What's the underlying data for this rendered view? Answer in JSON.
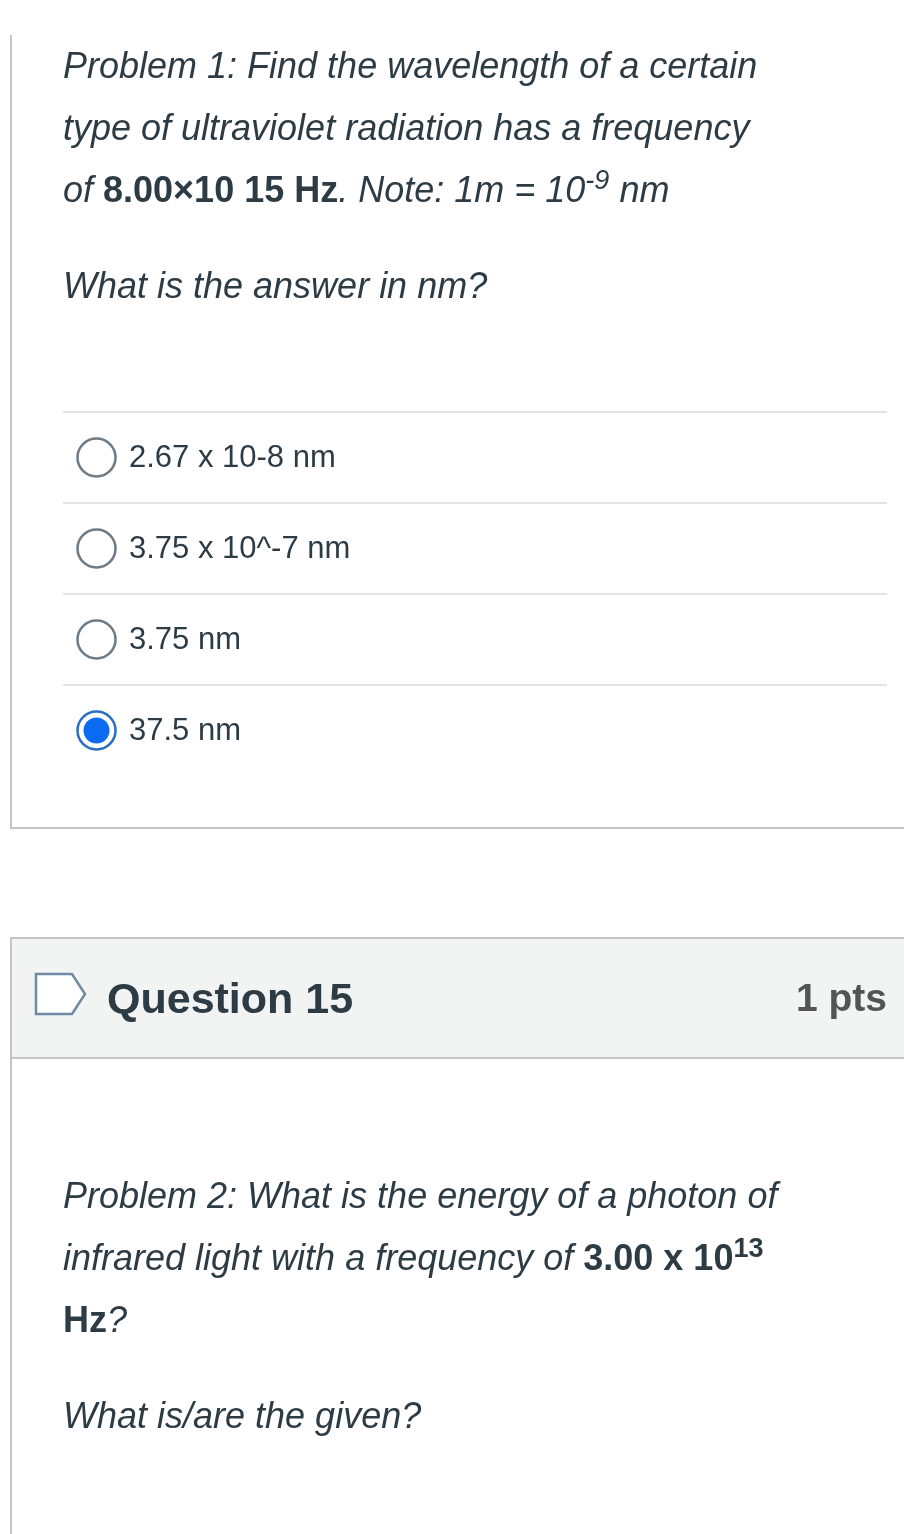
{
  "question_14": {
    "paragraphs": [
      "Problem 1: Find the wavelength of a certain type of ultraviolet radiation has a frequency of **8.00×10 15 Hz**. Note: 1m = 10$^{-9}$ nm",
      "What is the answer in nm?"
    ],
    "answers": [
      {
        "label": "2.67 x 10-8 nm",
        "selected": false
      },
      {
        "label": "3.75 x 10^-7 nm",
        "selected": false
      },
      {
        "label": "3.75 nm",
        "selected": false
      },
      {
        "label": "37.5 nm",
        "selected": true
      }
    ]
  },
  "question_15": {
    "title": "Question 15",
    "points": "1 pts",
    "paragraphs": [
      "Problem 2: What is the energy of a photon of infrared light with a frequency of **3.00 x 10$^{13}$ Hz**?",
      "What is/are the given?"
    ]
  }
}
